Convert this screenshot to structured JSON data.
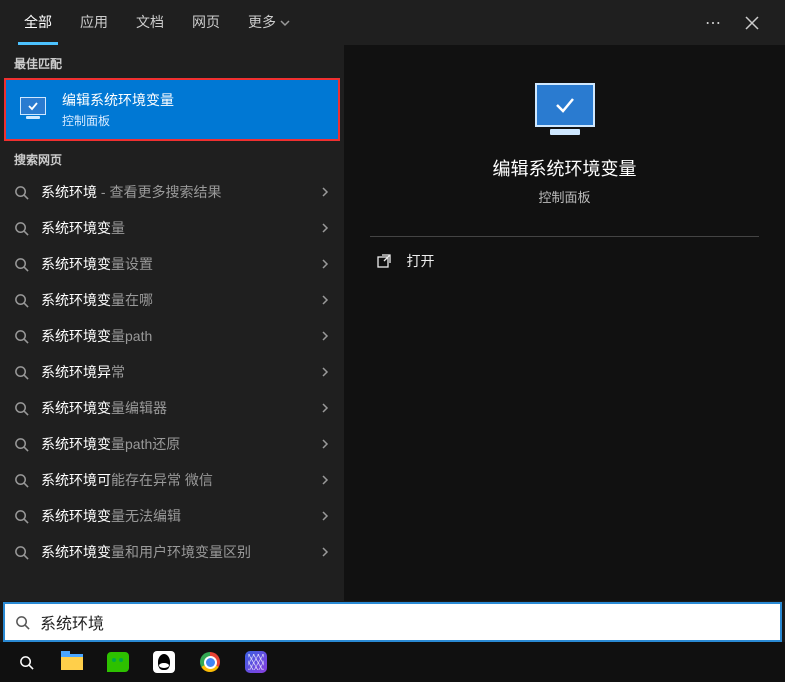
{
  "tabs": {
    "all": "全部",
    "apps": "应用",
    "docs": "文档",
    "web": "网页",
    "more": "更多"
  },
  "left": {
    "best_match_header": "最佳匹配",
    "best_match": {
      "title": "编辑系统环境变量",
      "subtitle": "控制面板"
    },
    "search_web_header": "搜索网页",
    "web_items": [
      {
        "prefix": "系统环境",
        "suffix": " - 查看更多搜索结果"
      },
      {
        "prefix": "系统环境变",
        "suffix": "量"
      },
      {
        "prefix": "系统环境变",
        "suffix": "量设置"
      },
      {
        "prefix": "系统环境变",
        "suffix": "量在哪"
      },
      {
        "prefix": "系统环境变",
        "suffix": "量path"
      },
      {
        "prefix": "系统环境异",
        "suffix": "常"
      },
      {
        "prefix": "系统环境变",
        "suffix": "量编辑器"
      },
      {
        "prefix": "系统环境变",
        "suffix": "量path还原"
      },
      {
        "prefix": "系统环境可",
        "suffix": "能存在异常 微信"
      },
      {
        "prefix": "系统环境变",
        "suffix": "量无法编辑"
      },
      {
        "prefix": "系统环境变",
        "suffix": "量和用户环境变量区别"
      }
    ]
  },
  "right": {
    "title": "编辑系统环境变量",
    "subtitle": "控制面板",
    "actions": {
      "open": "打开"
    }
  },
  "search": {
    "value": "系统环境"
  }
}
